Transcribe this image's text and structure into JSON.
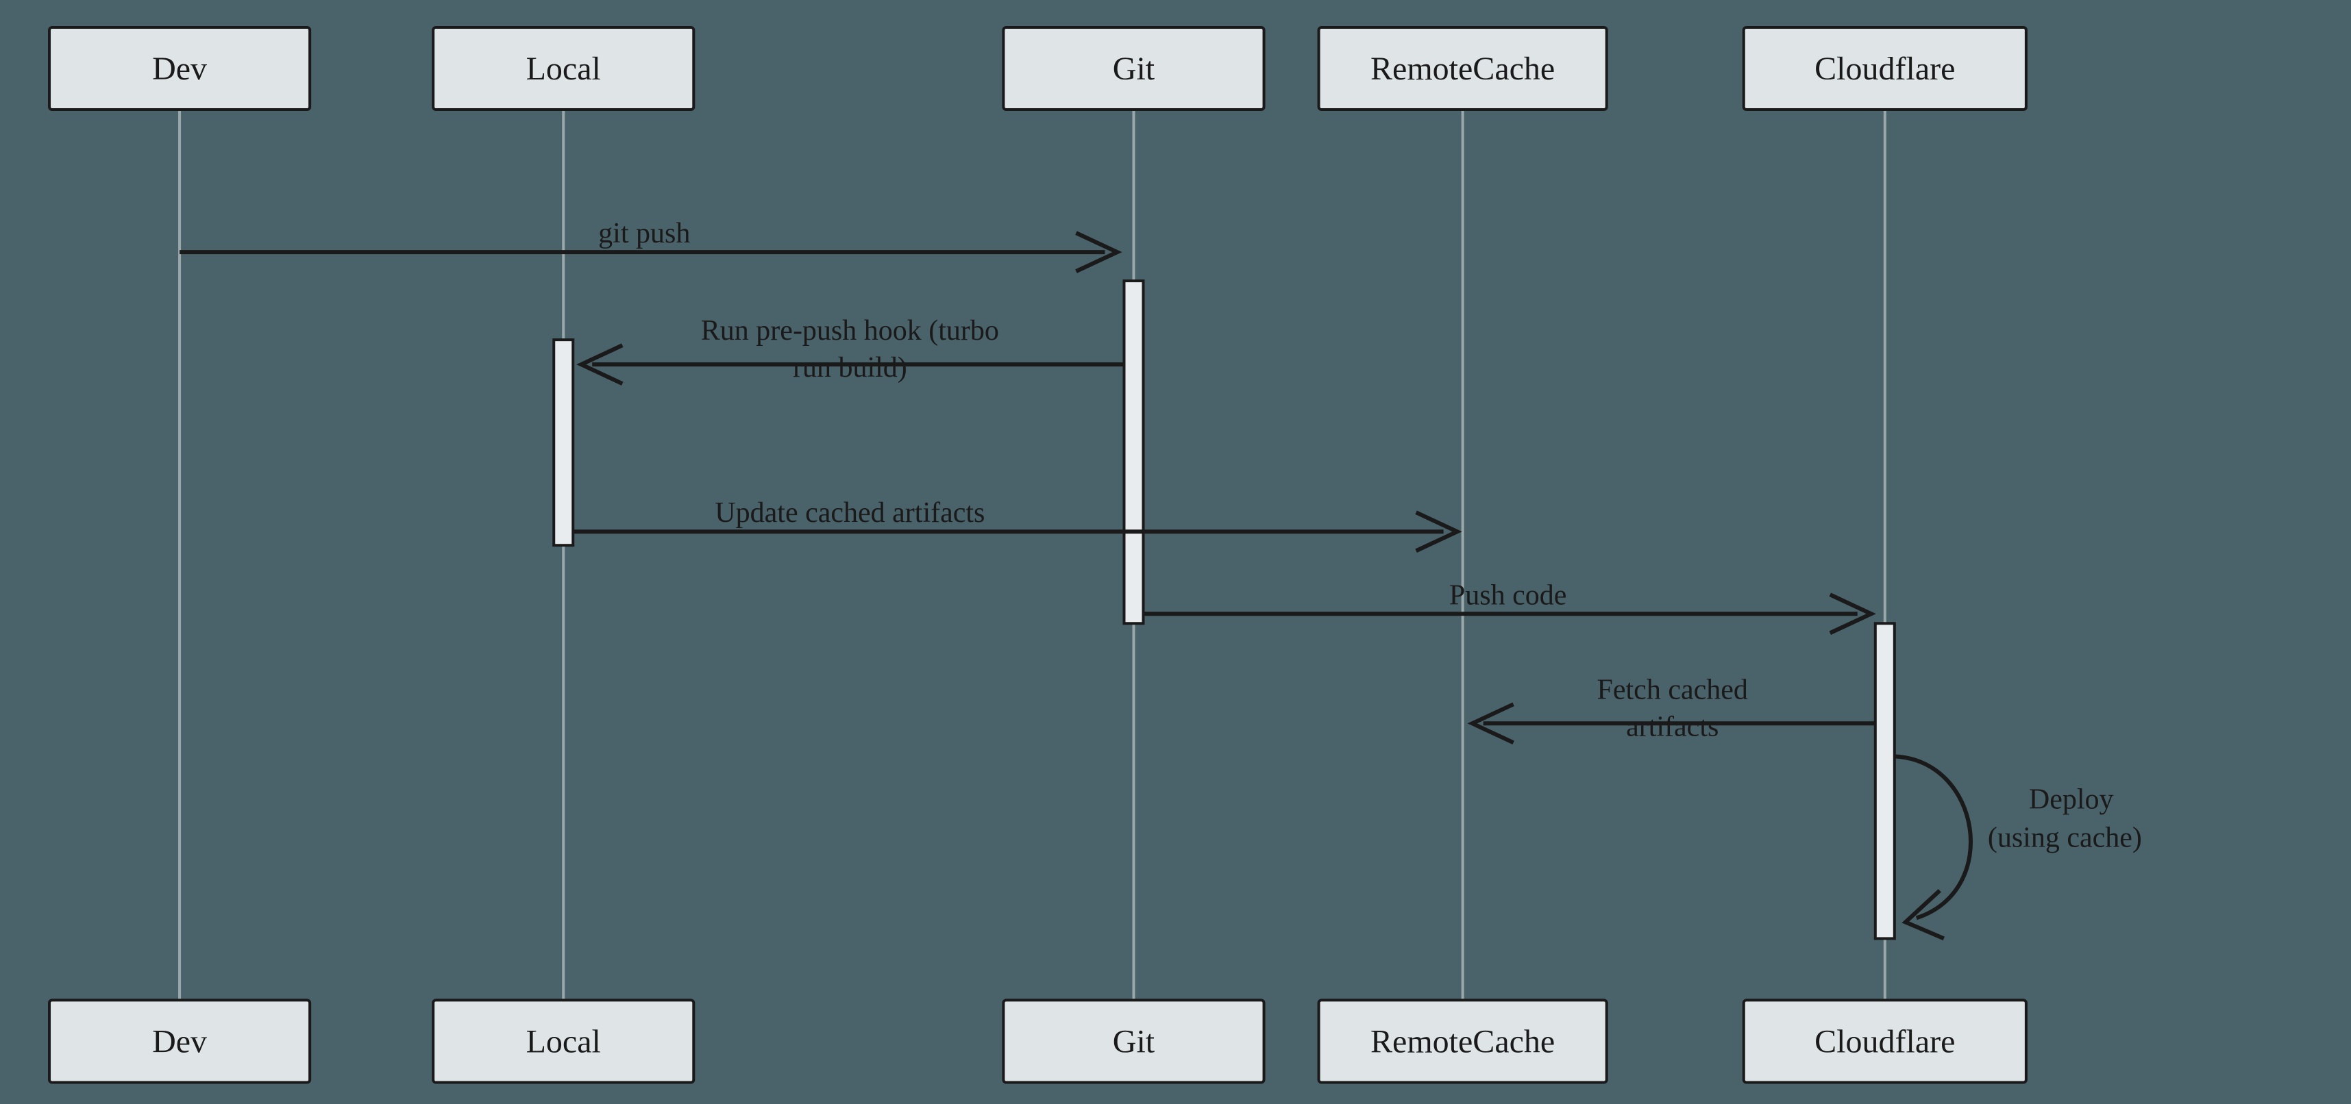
{
  "actors": {
    "dev": "Dev",
    "local": "Local",
    "git": "Git",
    "remotecache": "RemoteCache",
    "cloudflare": "Cloudflare"
  },
  "messages": {
    "git_push": "git push",
    "pre_push_hook_l1": "Run pre-push hook (turbo",
    "pre_push_hook_l2": "run build)",
    "update_artifacts": "Update cached artifacts",
    "push_code": "Push code",
    "fetch_artifacts_l1": "Fetch cached",
    "fetch_artifacts_l2": "artifacts",
    "deploy_l1": "Deploy",
    "deploy_l2": "(using cache)"
  }
}
